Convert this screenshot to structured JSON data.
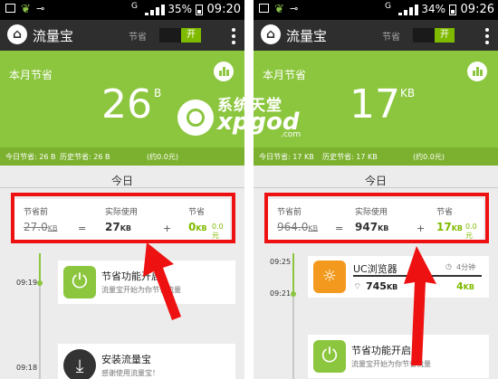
{
  "screens": [
    {
      "status": {
        "signal_label": "G",
        "battery": "35%",
        "time": "09:20"
      },
      "appbar": {
        "title": "流量宝",
        "save_label": "节省",
        "toggle_label": "开"
      },
      "summary": {
        "month_label": "本月节省",
        "saved_value": "26",
        "saved_unit": "B"
      },
      "infobar": {
        "today_label": "今日节省: 26 B",
        "history_label": "历史节省: 26 B",
        "history_yuan": "(约0.0元)"
      },
      "today_label": "今日",
      "stats": {
        "before_label": "节省前",
        "before_value": "27.0",
        "before_unit": "KB",
        "eq": "=",
        "actual_label": "实际使用",
        "actual_value": "27",
        "actual_unit": "KB",
        "plus": "+",
        "saved_label": "节省",
        "saved_value": "0",
        "saved_unit": "KB",
        "saved_yuan": "0.0元"
      },
      "timeline": {
        "t1": "09:19",
        "t2": "09:18"
      },
      "entries": [
        {
          "title": "节省功能开启",
          "desc": "流量宝开始为你节省流量"
        },
        {
          "title": "安装流量宝",
          "desc": "感谢使用流量宝！"
        }
      ]
    },
    {
      "status": {
        "signal_label": "G",
        "battery": "34%",
        "time": "09:26"
      },
      "appbar": {
        "title": "流量宝",
        "save_label": "节省",
        "toggle_label": "开"
      },
      "summary": {
        "month_label": "本月节省",
        "saved_value": "17",
        "saved_unit": "KB"
      },
      "infobar": {
        "today_label": "今日节省: 17 KB",
        "history_label": "历史节省: 17 KB",
        "history_yuan": "(约0.0元)"
      },
      "today_label": "今日",
      "stats": {
        "before_label": "节省前",
        "before_value": "964.0",
        "before_unit": "KB",
        "eq": "=",
        "actual_label": "实际使用",
        "actual_value": "947",
        "actual_unit": "KB",
        "plus": "+",
        "saved_label": "节省",
        "saved_value": "17",
        "saved_unit": "KB",
        "saved_yuan": "0.0元"
      },
      "timeline": {
        "t1": "09:25",
        "t2": "09:21"
      },
      "app_entry": {
        "name": "UC浏览器",
        "duration": "4分钟",
        "usage": "745",
        "usage_unit": "KB",
        "saved": "4",
        "saved_unit": "KB"
      },
      "entries": [
        {
          "title": "节省功能开启",
          "desc": "流量宝开始为你节省流量"
        }
      ]
    }
  ],
  "watermark": {
    "line1": "系统天堂",
    "line2": "xpgod",
    "line3": ".com"
  },
  "colors": {
    "accent_green": "#8cc63f",
    "highlight_red": "#e11111",
    "appbar": "#2e2e2e"
  }
}
